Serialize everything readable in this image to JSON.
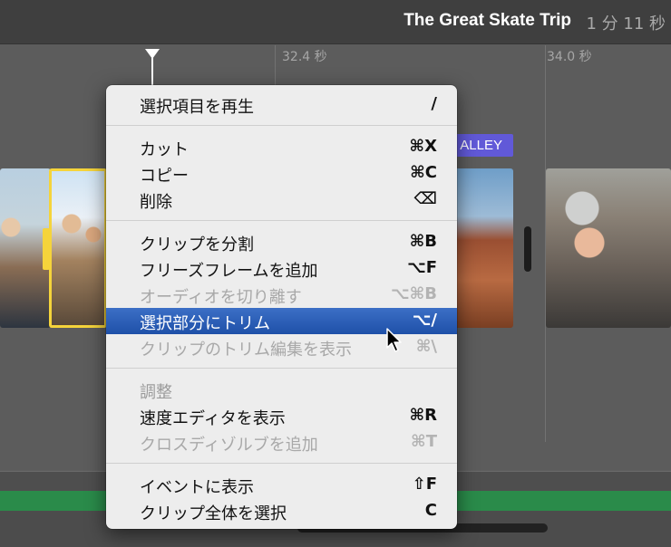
{
  "header": {
    "project_title": "The Great Skate Trip",
    "duration": "1 分 11 秒"
  },
  "ruler": {
    "labels": [
      "32.4 秒",
      "34.0 秒"
    ]
  },
  "clip_title_tag": "ALLEY",
  "context_menu": {
    "items": [
      {
        "label": "選択項目を再生",
        "shortcut": "/",
        "state": "normal"
      },
      {
        "label": "カット",
        "shortcut": "⌘X",
        "state": "normal"
      },
      {
        "label": "コピー",
        "shortcut": "⌘C",
        "state": "normal"
      },
      {
        "label": "削除",
        "shortcut": "⌫",
        "state": "normal"
      },
      {
        "label": "クリップを分割",
        "shortcut": "⌘B",
        "state": "normal"
      },
      {
        "label": "フリーズフレームを追加",
        "shortcut": "⌥F",
        "state": "normal"
      },
      {
        "label": "オーディオを切り離す",
        "shortcut": "⌥⌘B",
        "state": "disabled"
      },
      {
        "label": "選択部分にトリム",
        "shortcut": "⌥/",
        "state": "selected"
      },
      {
        "label": "クリップのトリム編集を表示",
        "shortcut": "⌘\\",
        "state": "disabled"
      },
      {
        "label": "調整",
        "shortcut": "",
        "state": "heading"
      },
      {
        "label": "速度エディタを表示",
        "shortcut": "⌘R",
        "state": "normal"
      },
      {
        "label": "クロスディゾルブを追加",
        "shortcut": "⌘T",
        "state": "disabled"
      },
      {
        "label": "イベントに表示",
        "shortcut": "⇧F",
        "state": "normal"
      },
      {
        "label": "クリップ全体を選択",
        "shortcut": "C",
        "state": "normal"
      }
    ]
  },
  "colors": {
    "selected_clip_border": "#f5d43b",
    "menu_highlight": "#2a5cb5",
    "title_tag": "#6159d8",
    "audio_track": "#2a8b4a"
  }
}
